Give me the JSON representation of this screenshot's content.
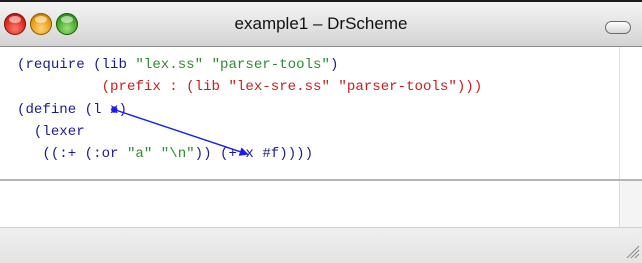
{
  "window": {
    "title": "example1 – DrScheme"
  },
  "editor": {
    "language": "scheme",
    "lines": [
      [
        "(require (lib ",
        "\"lex.ss\"",
        " ",
        "\"parser-tools\"",
        ")"
      ],
      [
        "          ",
        "(prefix : (lib ",
        "\"lex-sre.ss\"",
        " ",
        "\"parser-tools\"",
        ")))"
      ],
      [
        "(define (l ",
        "x",
        ")"
      ],
      [
        "  (lexer"
      ],
      [
        "   ((:+ (:or ",
        "\"a\"",
        " ",
        "\"\\n\"",
        ")) (+ ",
        "x",
        " #f))))"
      ]
    ]
  },
  "binding_arrow": {
    "from": "define-param-x",
    "to": "body-x",
    "color": "#1a1aff"
  },
  "colors": {
    "keyword": "#1c1c8c",
    "string": "#2f8c2f",
    "prefix_form": "#cc1c1c",
    "arrow": "#1a1aff"
  },
  "icons": [
    "close-button",
    "minimize-button",
    "zoom-button",
    "toolbar-toggle",
    "resize-grip-icon"
  ]
}
